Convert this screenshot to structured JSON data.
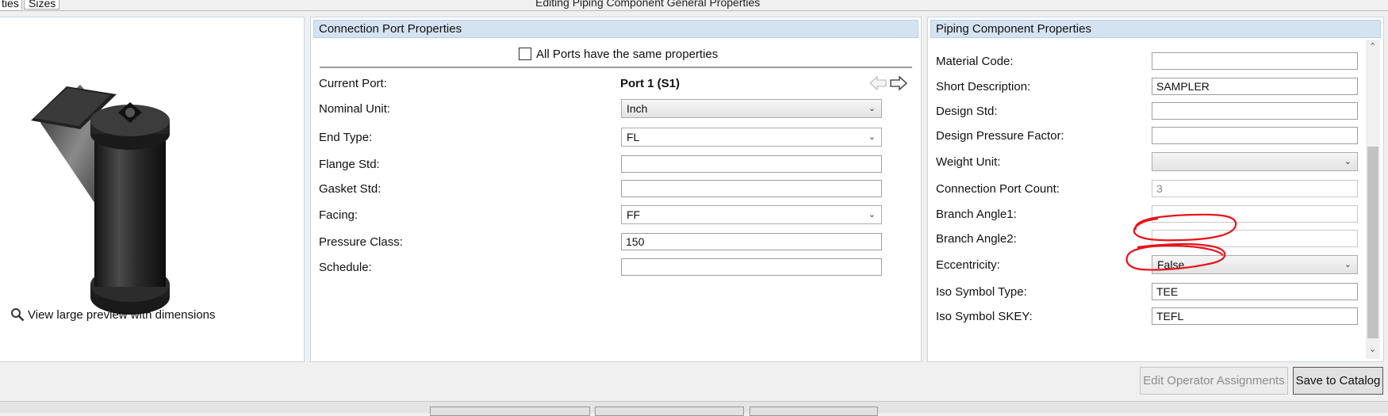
{
  "window": {
    "title": "Editing Piping Component General Properties"
  },
  "tabs": [
    {
      "label": "ties"
    },
    {
      "label": "Sizes"
    }
  ],
  "preview": {
    "link_label": "View large preview with dimensions"
  },
  "port_panel": {
    "title": "Connection Port Properties",
    "same_props_label": "All Ports have the same properties",
    "same_props_checked": false,
    "current_port_label": "Current Port:",
    "current_port_value": "Port 1 (S1)",
    "fields": {
      "nominal_unit": {
        "label": "Nominal Unit:",
        "value": "Inch"
      },
      "end_type": {
        "label": "End Type:",
        "value": "FL"
      },
      "flange_std": {
        "label": "Flange Std:",
        "value": ""
      },
      "gasket_std": {
        "label": "Gasket Std:",
        "value": ""
      },
      "facing": {
        "label": "Facing:",
        "value": "FF"
      },
      "pressure_class": {
        "label": "Pressure Class:",
        "value": "150"
      },
      "schedule": {
        "label": "Schedule:",
        "value": ""
      }
    }
  },
  "comp_panel": {
    "title": "Piping Component Properties",
    "fields": {
      "material_code": {
        "label": "Material Code:",
        "value": ""
      },
      "short_description": {
        "label": "Short Description:",
        "value": "SAMPLER"
      },
      "design_std": {
        "label": "Design Std:",
        "value": ""
      },
      "design_pressure_factor": {
        "label": "Design Pressure Factor:",
        "value": ""
      },
      "weight_unit": {
        "label": "Weight Unit:",
        "value": ""
      },
      "connection_port_count": {
        "label": "Connection Port Count:",
        "value": "3"
      },
      "branch_angle1": {
        "label": "Branch Angle1:",
        "value": ""
      },
      "branch_angle2": {
        "label": "Branch Angle2:",
        "value": ""
      },
      "eccentricity": {
        "label": "Eccentricity:",
        "value": "False"
      },
      "iso_symbol_type": {
        "label": "Iso Symbol Type:",
        "value": "TEE"
      },
      "iso_symbol_skey": {
        "label": "Iso Symbol SKEY:",
        "value": "TEFL"
      }
    }
  },
  "buttons": {
    "edit_operator": "Edit Operator Assignments",
    "save_catalog": "Save to Catalog"
  },
  "colors": {
    "panel_header": "#d5e3f1",
    "panel_border": "#c6d6e6",
    "annotation_red": "#e8141a"
  }
}
